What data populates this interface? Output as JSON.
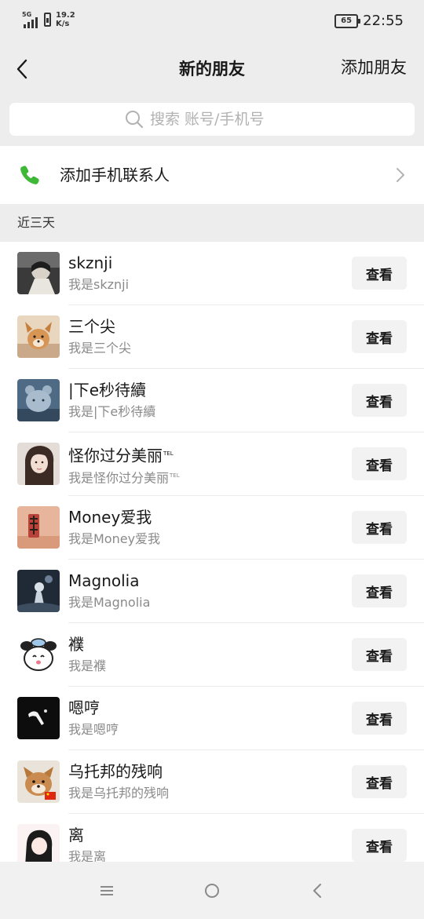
{
  "status_bar": {
    "network": "5G",
    "speed_value": "19.2",
    "speed_unit": "K/s",
    "battery": "65",
    "time": "22:55"
  },
  "nav": {
    "title": "新的朋友",
    "action": "添加朋友"
  },
  "search": {
    "placeholder": "搜索 账号/手机号"
  },
  "add_contacts": {
    "label": "添加手机联系人"
  },
  "section": {
    "label": "近三天"
  },
  "friends": [
    {
      "name": "skznji",
      "message": "我是skznji",
      "button": "查看"
    },
    {
      "name": "三个尖",
      "message": "我是三个尖",
      "button": "查看"
    },
    {
      "name": "|下e秒待續",
      "message": "我是|下e秒待續",
      "button": "查看"
    },
    {
      "name": "怪你过分美丽",
      "message": "我是怪你过分美丽",
      "name_sup": "TEL",
      "message_sup": "TEL",
      "button": "查看"
    },
    {
      "name": "Money爱我",
      "message": "我是Money爱我",
      "button": "查看"
    },
    {
      "name": "Magnolia",
      "message": "我是Magnolia",
      "button": "查看"
    },
    {
      "name": "襥",
      "message": "我是襥",
      "button": "查看"
    },
    {
      "name": "嗯哼",
      "message": "我是嗯哼",
      "button": "查看"
    },
    {
      "name": "乌托邦的残响",
      "message": "我是乌托邦的残响",
      "button": "查看"
    },
    {
      "name": "离",
      "message": "我是离",
      "button": "查看"
    }
  ],
  "colors": {
    "background": "#ededed",
    "phone_icon": "#3fb838",
    "button_bg": "#f2f2f2",
    "secondary_text": "#8a8a8a"
  },
  "icons": {
    "back": "chevron-left-icon",
    "search": "search-icon",
    "phone": "phone-icon",
    "chevron": "chevron-right-icon",
    "menu": "menu-icon",
    "home": "home-circle-icon",
    "system_back": "system-back-icon"
  }
}
